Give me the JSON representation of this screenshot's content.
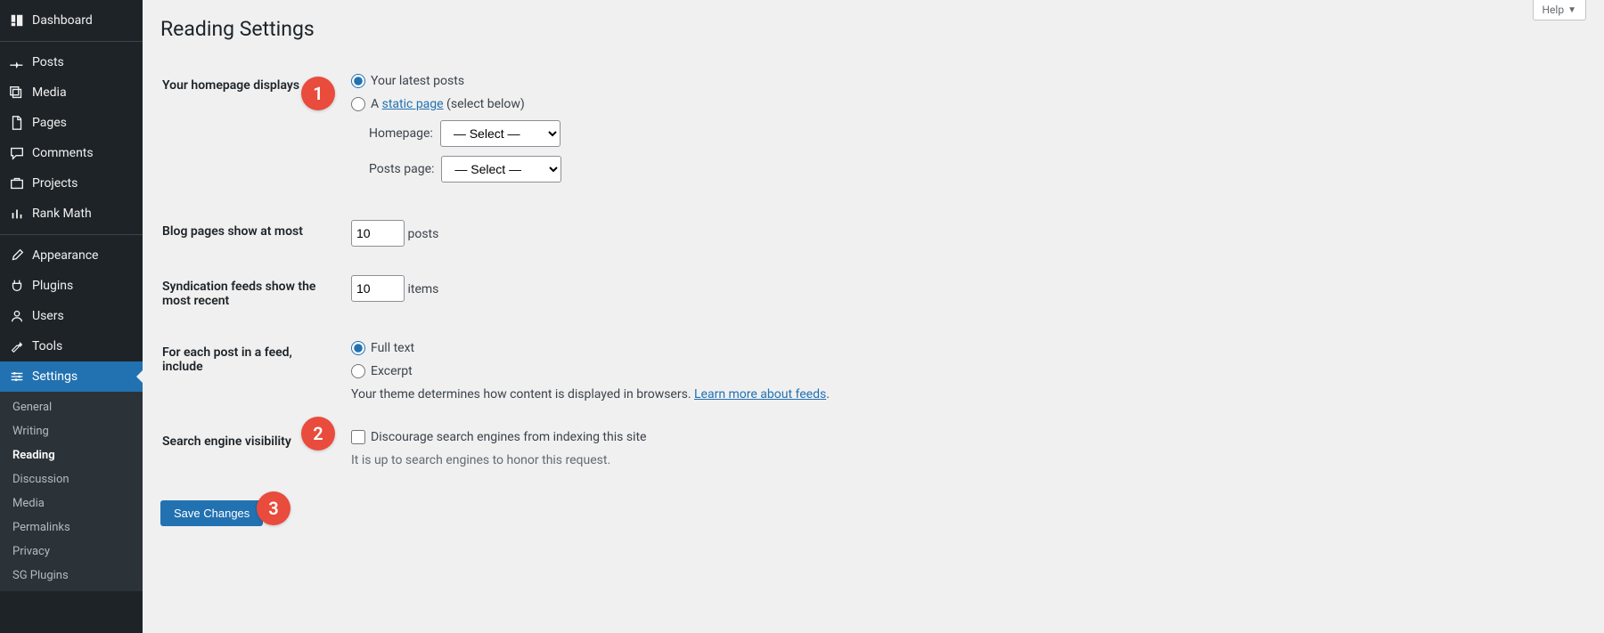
{
  "header": {
    "title": "Reading Settings",
    "help_label": "Help"
  },
  "sidebar": {
    "items": [
      {
        "label": "Dashboard",
        "icon": "dashboard"
      },
      {
        "label": "Posts",
        "icon": "pin"
      },
      {
        "label": "Media",
        "icon": "media"
      },
      {
        "label": "Pages",
        "icon": "page"
      },
      {
        "label": "Comments",
        "icon": "comment"
      },
      {
        "label": "Projects",
        "icon": "portfolio"
      },
      {
        "label": "Rank Math",
        "icon": "chart"
      },
      {
        "label": "Appearance",
        "icon": "brush"
      },
      {
        "label": "Plugins",
        "icon": "plug"
      },
      {
        "label": "Users",
        "icon": "user"
      },
      {
        "label": "Tools",
        "icon": "wrench"
      },
      {
        "label": "Settings",
        "icon": "sliders"
      }
    ],
    "submenu": [
      {
        "label": "General"
      },
      {
        "label": "Writing"
      },
      {
        "label": "Reading",
        "active": true
      },
      {
        "label": "Discussion"
      },
      {
        "label": "Media"
      },
      {
        "label": "Permalinks"
      },
      {
        "label": "Privacy"
      },
      {
        "label": "SG Plugins"
      }
    ]
  },
  "settings": {
    "homepage_label": "Your homepage displays",
    "homepage_option_latest": "Your latest posts",
    "homepage_option_static_prefix": "A ",
    "homepage_option_static_link": "static page",
    "homepage_option_static_suffix": " (select below)",
    "homepage_select_label": "Homepage:",
    "posts_page_select_label": "Posts page:",
    "select_placeholder": "— Select —",
    "blog_pages_label": "Blog pages show at most",
    "blog_pages_value": 10,
    "blog_pages_suffix": "posts",
    "syndication_label": "Syndication feeds show the most recent",
    "syndication_value": 10,
    "syndication_suffix": "items",
    "feed_include_label": "For each post in a feed, include",
    "feed_option_full": "Full text",
    "feed_option_excerpt": "Excerpt",
    "feed_theme_note_prefix": "Your theme determines how content is displayed in browsers. ",
    "feed_theme_note_link": "Learn more about feeds",
    "feed_theme_note_suffix": ".",
    "search_visibility_label": "Search engine visibility",
    "discourage_label": "Discourage search engines from indexing this site",
    "discourage_note": "It is up to search engines to honor this request.",
    "save_button": "Save Changes"
  },
  "annotations": {
    "a1": "1",
    "a2": "2",
    "a3": "3"
  }
}
